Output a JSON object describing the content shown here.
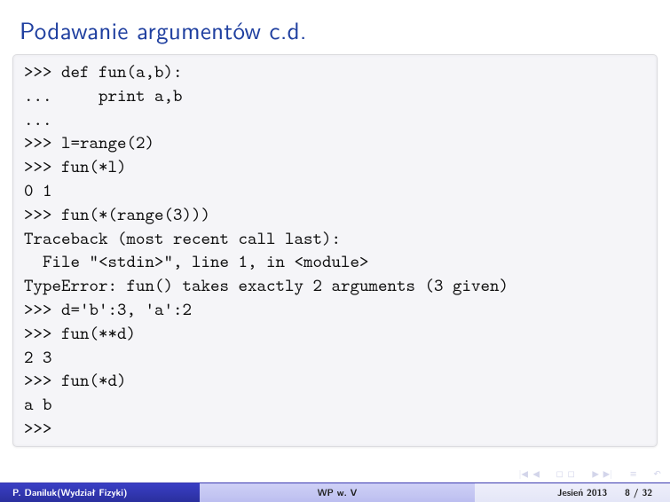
{
  "slide": {
    "title": "Podawanie argumentów c.d.",
    "code": ">>> def fun(a,b):\n...     print a,b\n...\n>>> l=range(2)\n>>> fun(*l)\n0 1\n>>> fun(*(range(3)))\nTraceback (most recent call last):\n  File \"<stdin>\", line 1, in <module>\nTypeError: fun() takes exactly 2 arguments (3 given)\n>>> d='b':3, 'a':2\n>>> fun(**d)\n2 3\n>>> fun(*d)\na b\n>>>"
  },
  "footer": {
    "author": "P. Daniluk(Wydział Fizyki)",
    "talk": "WP w. V",
    "date": "Jesień 2013",
    "page_current": "8",
    "page_sep": " / ",
    "page_total": "32"
  },
  "nav": {
    "first": "|◀",
    "prev": "◀",
    "prev_box": "◻",
    "next_box": "◻",
    "next": "▶",
    "last": "▶|",
    "back": "↶",
    "menu": "≡"
  }
}
